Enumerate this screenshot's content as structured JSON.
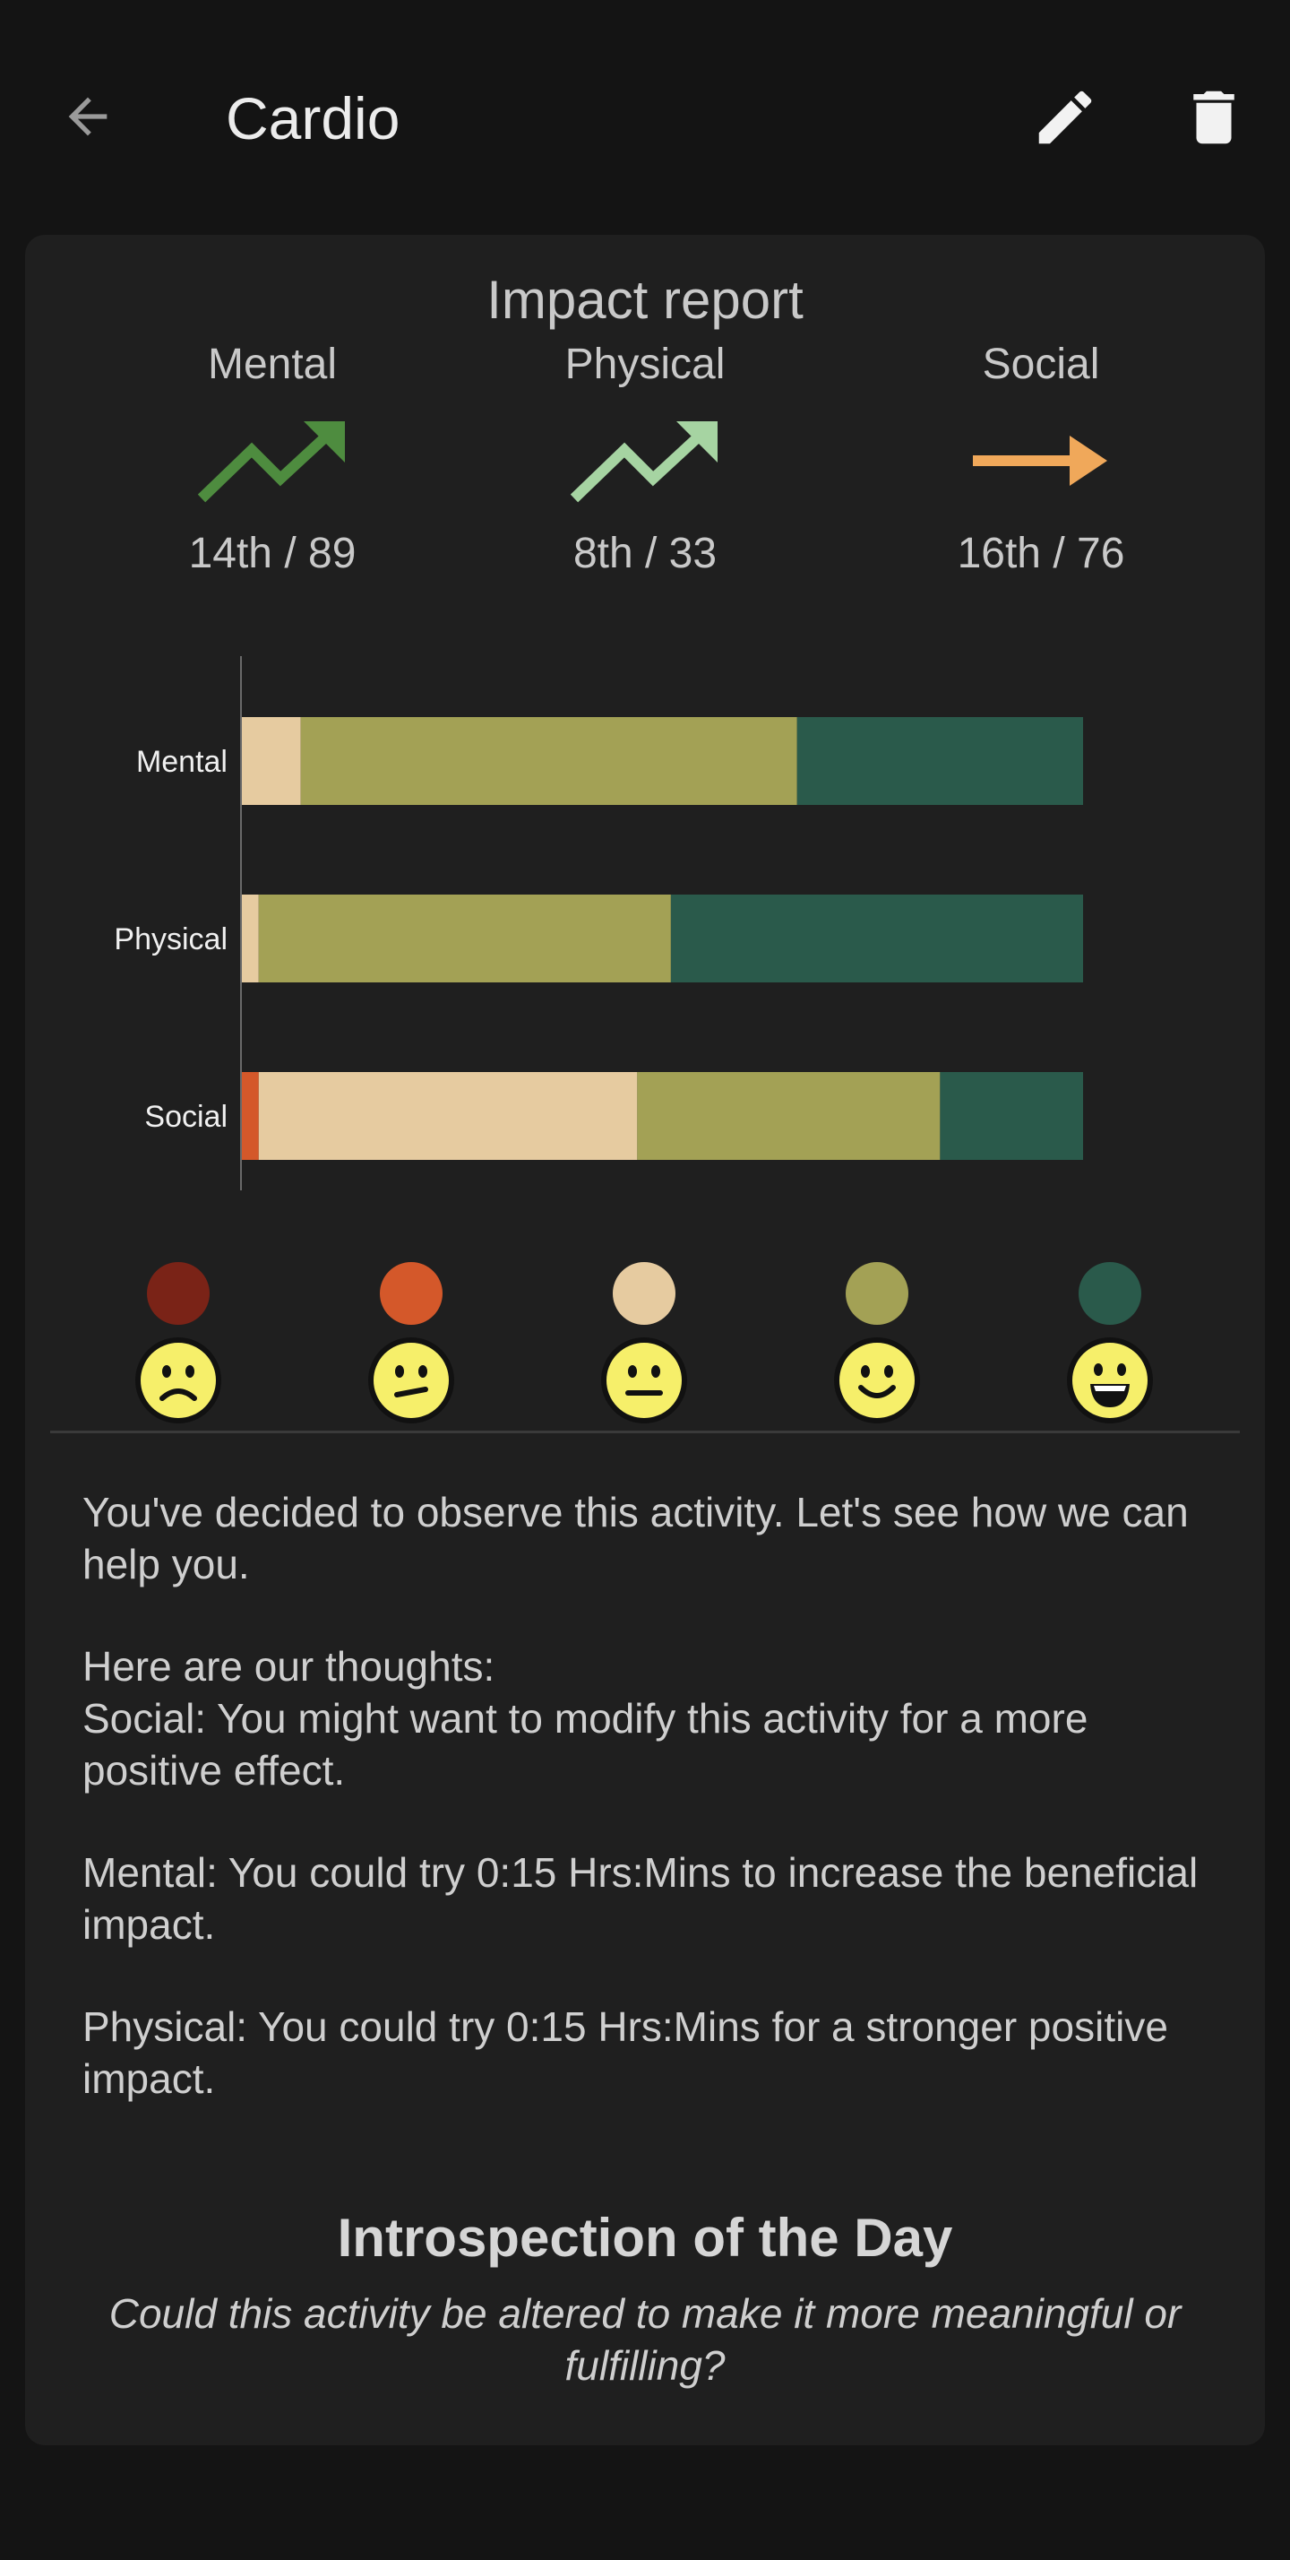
{
  "appbar": {
    "title": "Cardio",
    "back_icon": "arrow-left-icon",
    "edit_icon": "pencil-icon",
    "delete_icon": "trash-icon"
  },
  "impact": {
    "title": "Impact report",
    "categories": [
      {
        "label": "Mental",
        "rank": "14th / 89",
        "trend": "up",
        "color": "#4e8c3f"
      },
      {
        "label": "Physical",
        "rank": "8th / 33",
        "trend": "up",
        "color": "#a6d4a2"
      },
      {
        "label": "Social",
        "rank": "16th / 76",
        "trend": "flat",
        "color": "#f0a85a"
      }
    ]
  },
  "chart_data": {
    "type": "bar",
    "orientation": "horizontal",
    "stacked": true,
    "categories": [
      "Mental",
      "Physical",
      "Social"
    ],
    "series": [
      {
        "color": "#7a2317",
        "values": [
          0,
          0,
          0
        ]
      },
      {
        "color": "#d4582a",
        "values": [
          0,
          0,
          0.02
        ]
      },
      {
        "color": "#e6cba0",
        "values": [
          0.07,
          0.02,
          0.45
        ]
      },
      {
        "color": "#a3a155",
        "values": [
          0.59,
          0.49,
          0.36
        ]
      },
      {
        "color": "#2a5a4b",
        "values": [
          0.34,
          0.49,
          0.17
        ]
      }
    ],
    "xlim": [
      0,
      1
    ],
    "grid": false
  },
  "legend": {
    "items": [
      {
        "color": "#7a2317",
        "face": "sad-face-icon"
      },
      {
        "color": "#d4582a",
        "face": "uneasy-face-icon"
      },
      {
        "color": "#e6cba0",
        "face": "neutral-face-icon"
      },
      {
        "color": "#a3a155",
        "face": "smile-face-icon"
      },
      {
        "color": "#2a5a4b",
        "face": "grin-face-icon"
      }
    ]
  },
  "thoughts": {
    "intro": "You've decided to observe this activity. Let's see how we can help you.",
    "heading": "Here are our thoughts:",
    "social": "Social: You might want to modify this activity for a more positive effect.",
    "mental": "Mental: You could try 0:15 Hrs:Mins to increase the beneficial impact.",
    "physical": "Physical: You could try 0:15 Hrs:Mins for a stronger positive impact."
  },
  "introspection": {
    "title": "Introspection of the Day",
    "question": "Could this activity be altered to make it more meaningful or fulfilling?"
  }
}
